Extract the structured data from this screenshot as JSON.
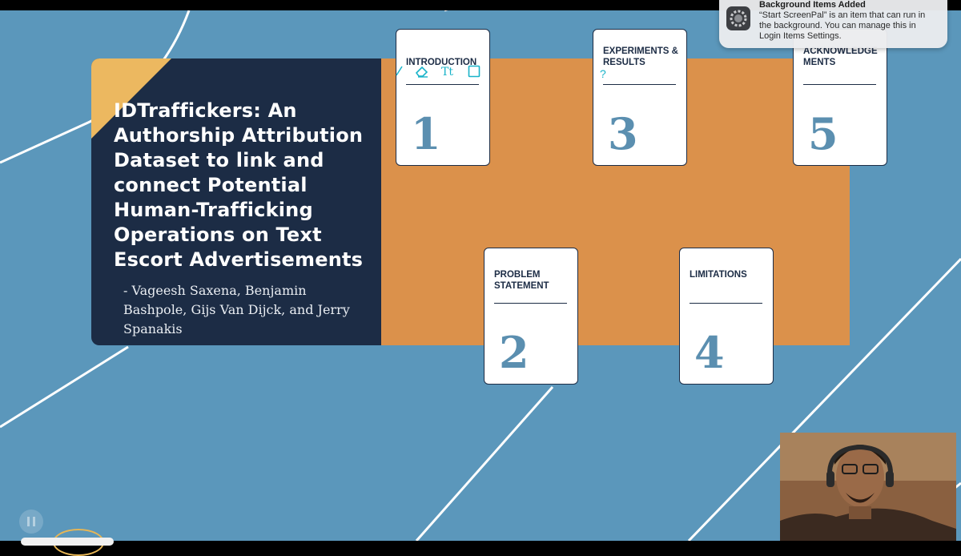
{
  "slide": {
    "title": "IDTraffickers: An Authorship Attribution Dataset to link and connect Potential Human-Trafficking Operations on Text Escort Advertisements",
    "authors": "- Vageesh Saxena, Benjamin Bashpole, Gijs Van Dijck, and Jerry Spanakis",
    "colors": {
      "background": "#5b97bb",
      "title_panel": "#1c2c45",
      "accent_panel": "#db914b",
      "corner_flag": "#ecb860",
      "card_number": "#5b8fb0"
    }
  },
  "cards": [
    {
      "label": "INTRODUCTION",
      "number": "1"
    },
    {
      "label": "PROBLEM STATEMENT",
      "number": "2"
    },
    {
      "label": "EXPERIMENTS & RESULTS",
      "number": "3"
    },
    {
      "label": "LIMITATIONS",
      "number": "4"
    },
    {
      "label": "ACKNOWLEDGE MENTS",
      "number": "5"
    }
  ],
  "annotation_toolbar": {
    "icons": [
      "pen-icon",
      "eraser-icon",
      "text-tool-icon",
      "rectangle-tool-icon",
      "help-icon"
    ],
    "text_tool_glyph": "Tt",
    "help_glyph": "?"
  },
  "notification": {
    "title": "Background Items Added",
    "body": "“Start ScreenPal” is an item that can run in the background. You can manage this in Login Items Settings.",
    "icon": "gear-icon"
  },
  "player": {
    "pause_icon": "pause-icon"
  }
}
